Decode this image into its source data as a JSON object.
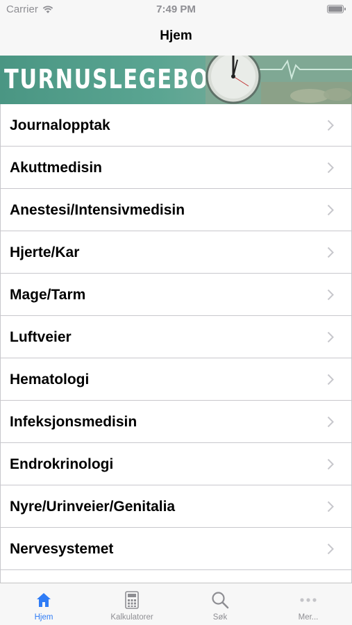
{
  "status_bar": {
    "carrier": "Carrier",
    "time": "7:49 PM",
    "battery_level": 1.0
  },
  "nav": {
    "title": "Hjem"
  },
  "banner": {
    "text": "TURNUSLEGEBOKA"
  },
  "list": {
    "items": [
      {
        "label": "Journalopptak"
      },
      {
        "label": "Akuttmedisin"
      },
      {
        "label": "Anestesi/Intensivmedisin"
      },
      {
        "label": "Hjerte/Kar"
      },
      {
        "label": "Mage/Tarm"
      },
      {
        "label": "Luftveier"
      },
      {
        "label": "Hematologi"
      },
      {
        "label": "Infeksjonsmedisin"
      },
      {
        "label": "Endrokrinologi"
      },
      {
        "label": "Nyre/Urinveier/Genitalia"
      },
      {
        "label": "Nervesystemet"
      }
    ]
  },
  "tabs": [
    {
      "label": "Hjem",
      "icon": "home-icon",
      "active": true
    },
    {
      "label": "Kalkulatorer",
      "icon": "calculator-icon",
      "active": false
    },
    {
      "label": "Søk",
      "icon": "search-icon",
      "active": false
    },
    {
      "label": "Mer...",
      "icon": "more-icon",
      "active": false
    }
  ],
  "colors": {
    "accent": "#2f7cf6",
    "inactive": "#8e8e93",
    "banner": "#4a9683"
  }
}
